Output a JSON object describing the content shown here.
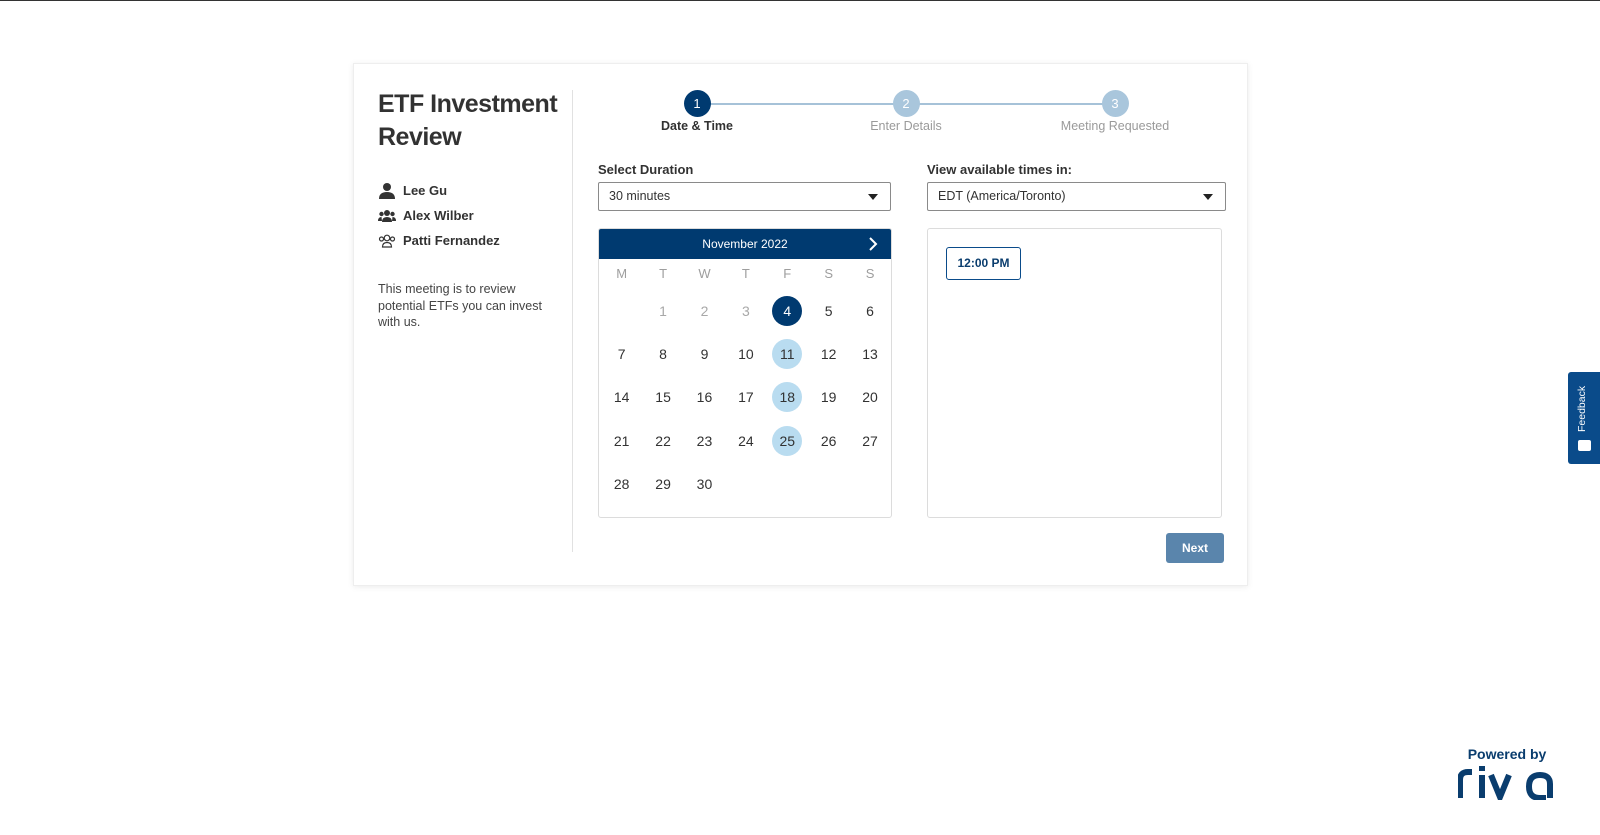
{
  "meeting": {
    "title": "ETF Investment Review",
    "attendees": [
      {
        "name": "Lee Gu",
        "icon": "user-icon"
      },
      {
        "name": "Alex Wilber",
        "icon": "users-icon"
      },
      {
        "name": "Patti Fernandez",
        "icon": "users-outline-icon"
      }
    ],
    "description": "This meeting is to review potential ETFs you can invest with us."
  },
  "stepper": {
    "steps": [
      {
        "number": "1",
        "label": "Date & Time",
        "active": true
      },
      {
        "number": "2",
        "label": "Enter Details",
        "active": false
      },
      {
        "number": "3",
        "label": "Meeting Requested",
        "active": false
      }
    ]
  },
  "duration": {
    "label": "Select Duration",
    "value": "30 minutes"
  },
  "timezone": {
    "label": "View available times in:",
    "value": "EDT (America/Toronto)"
  },
  "calendar": {
    "month": "November 2022",
    "weekdays": [
      "M",
      "T",
      "W",
      "T",
      "F",
      "S",
      "S"
    ],
    "start_offset": 1,
    "days": 30,
    "muted_days": [
      1,
      2,
      3
    ],
    "selected_day": 4,
    "available_days": [
      11,
      18,
      25
    ]
  },
  "times": {
    "slots": [
      "12:00 PM"
    ]
  },
  "actions": {
    "next_label": "Next"
  },
  "feedback": {
    "label": "Feedback"
  },
  "branding": {
    "powered_by": "Powered by",
    "logo": "riva"
  },
  "colors": {
    "primary": "#003a70",
    "available": "#b9dcf0",
    "button": "#5a85ac",
    "step_inactive": "#a9c6dc"
  }
}
